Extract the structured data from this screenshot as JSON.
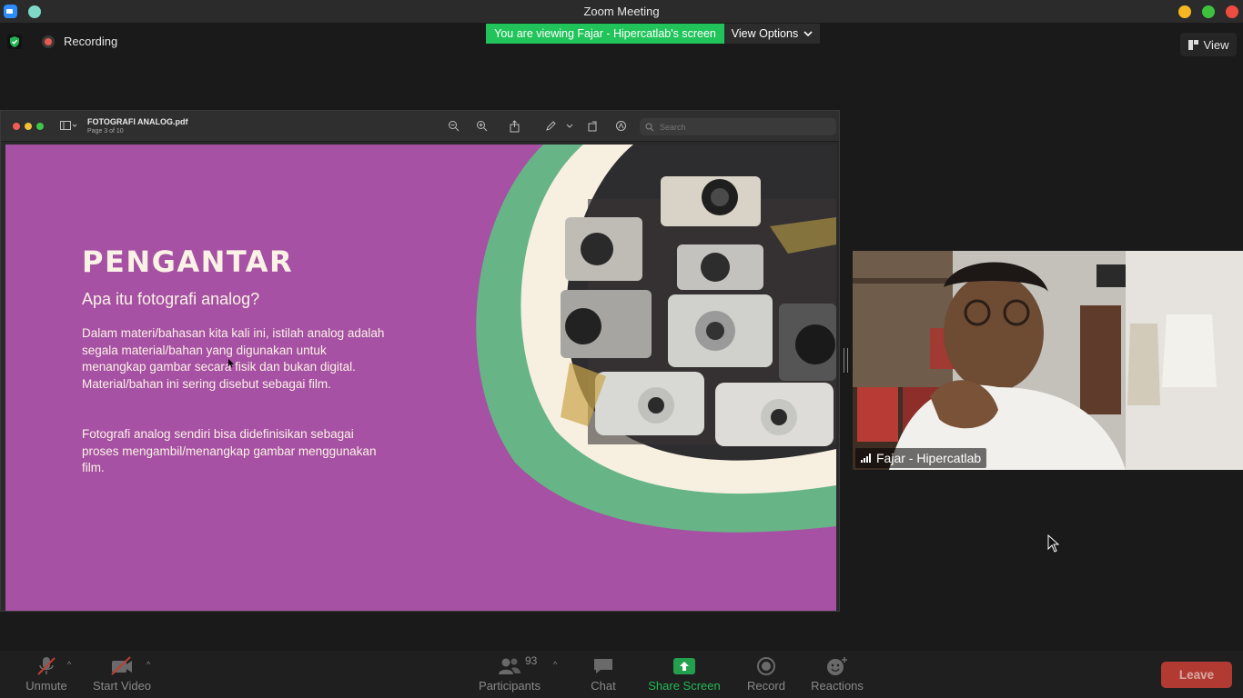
{
  "window": {
    "title": "Zoom Meeting"
  },
  "topbar": {
    "recording_label": "Recording",
    "viewing_banner": "You are viewing Fajar - Hipercatlab's screen",
    "view_options_label": "View Options",
    "view_label": "View"
  },
  "pdf": {
    "filename": "FOTOGRAFI ANALOG.pdf",
    "page_info": "Page 3 of 10",
    "search_placeholder": "Search"
  },
  "slide": {
    "title": "PENGANTAR",
    "subtitle": "Apa itu fotografi analog?",
    "paragraph1": "Dalam materi/bahasan kita kali ini, istilah analog adalah segala material/bahan yang digunakan untuk menangkap gambar secara fisik dan bukan digital. Material/bahan ini sering disebut sebagai film.",
    "paragraph2": "Fotografi analog sendiri bisa didefinisikan sebagai proses mengambil/menangkap gambar menggunakan film.",
    "colors": {
      "background": "#a651a3",
      "arc_green": "#67b586",
      "arc_cream": "#f7efe0",
      "text": "#fbf2e6"
    }
  },
  "participant": {
    "name": "Fajar - Hipercatlab"
  },
  "toolbar": {
    "unmute_label": "Unmute",
    "start_video_label": "Start Video",
    "participants_label": "Participants",
    "participants_count": "93",
    "chat_label": "Chat",
    "share_screen_label": "Share Screen",
    "record_label": "Record",
    "reactions_label": "Reactions",
    "leave_label": "Leave"
  }
}
